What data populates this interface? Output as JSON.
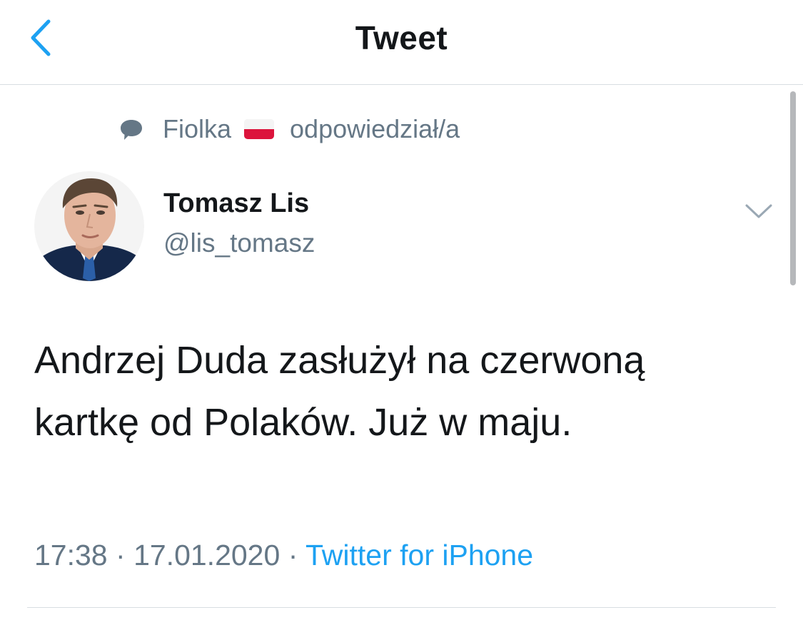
{
  "header": {
    "title": "Tweet",
    "back_icon": "chevron-left-icon"
  },
  "reply_context": {
    "icon": "speech-bubble-icon",
    "name": "Fiolka",
    "flag": "poland-flag",
    "text": "odpowiedział/a"
  },
  "author": {
    "name": "Tomasz Lis",
    "handle": "@lis_tomasz"
  },
  "tweet": {
    "text_line1": "Andrzej Duda zasłużył na czerwoną",
    "text_line2": "kartkę od Polaków. Już w maju."
  },
  "meta": {
    "time": "17:38",
    "separator": "·",
    "date": "17.01.2020",
    "source": "Twitter for iPhone"
  },
  "colors": {
    "accent": "#1da1f2",
    "text_primary": "#14171a",
    "text_secondary": "#657786",
    "divider": "#d8dde2"
  }
}
